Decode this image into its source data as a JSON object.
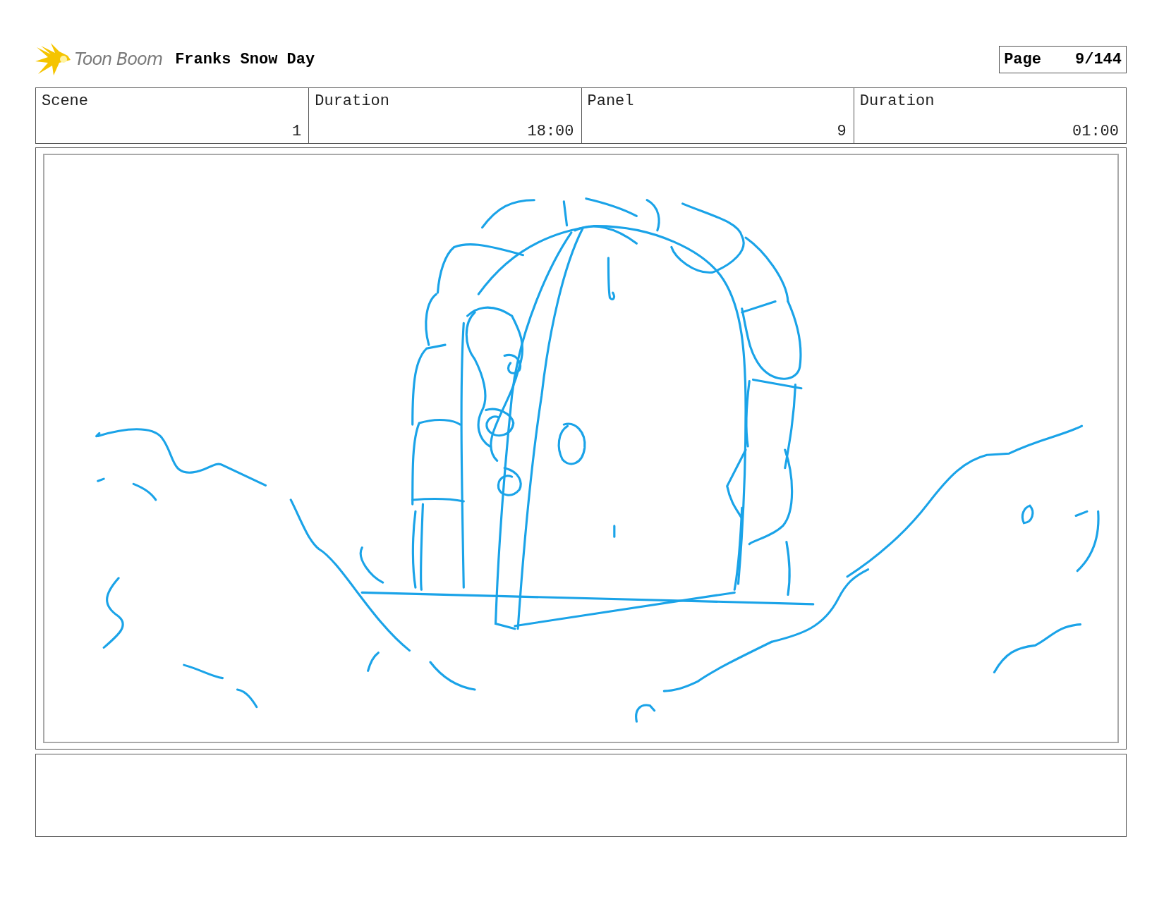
{
  "header": {
    "logo_text": "Toon Boom",
    "project_title": "Franks Snow Day",
    "page_label": "Page",
    "page_number": "9/144"
  },
  "info_fields": [
    {
      "label": "Scene",
      "value": "1"
    },
    {
      "label": "Duration",
      "value": "18:00"
    },
    {
      "label": "Panel",
      "value": "9"
    },
    {
      "label": "Duration",
      "value": "01:00"
    }
  ]
}
